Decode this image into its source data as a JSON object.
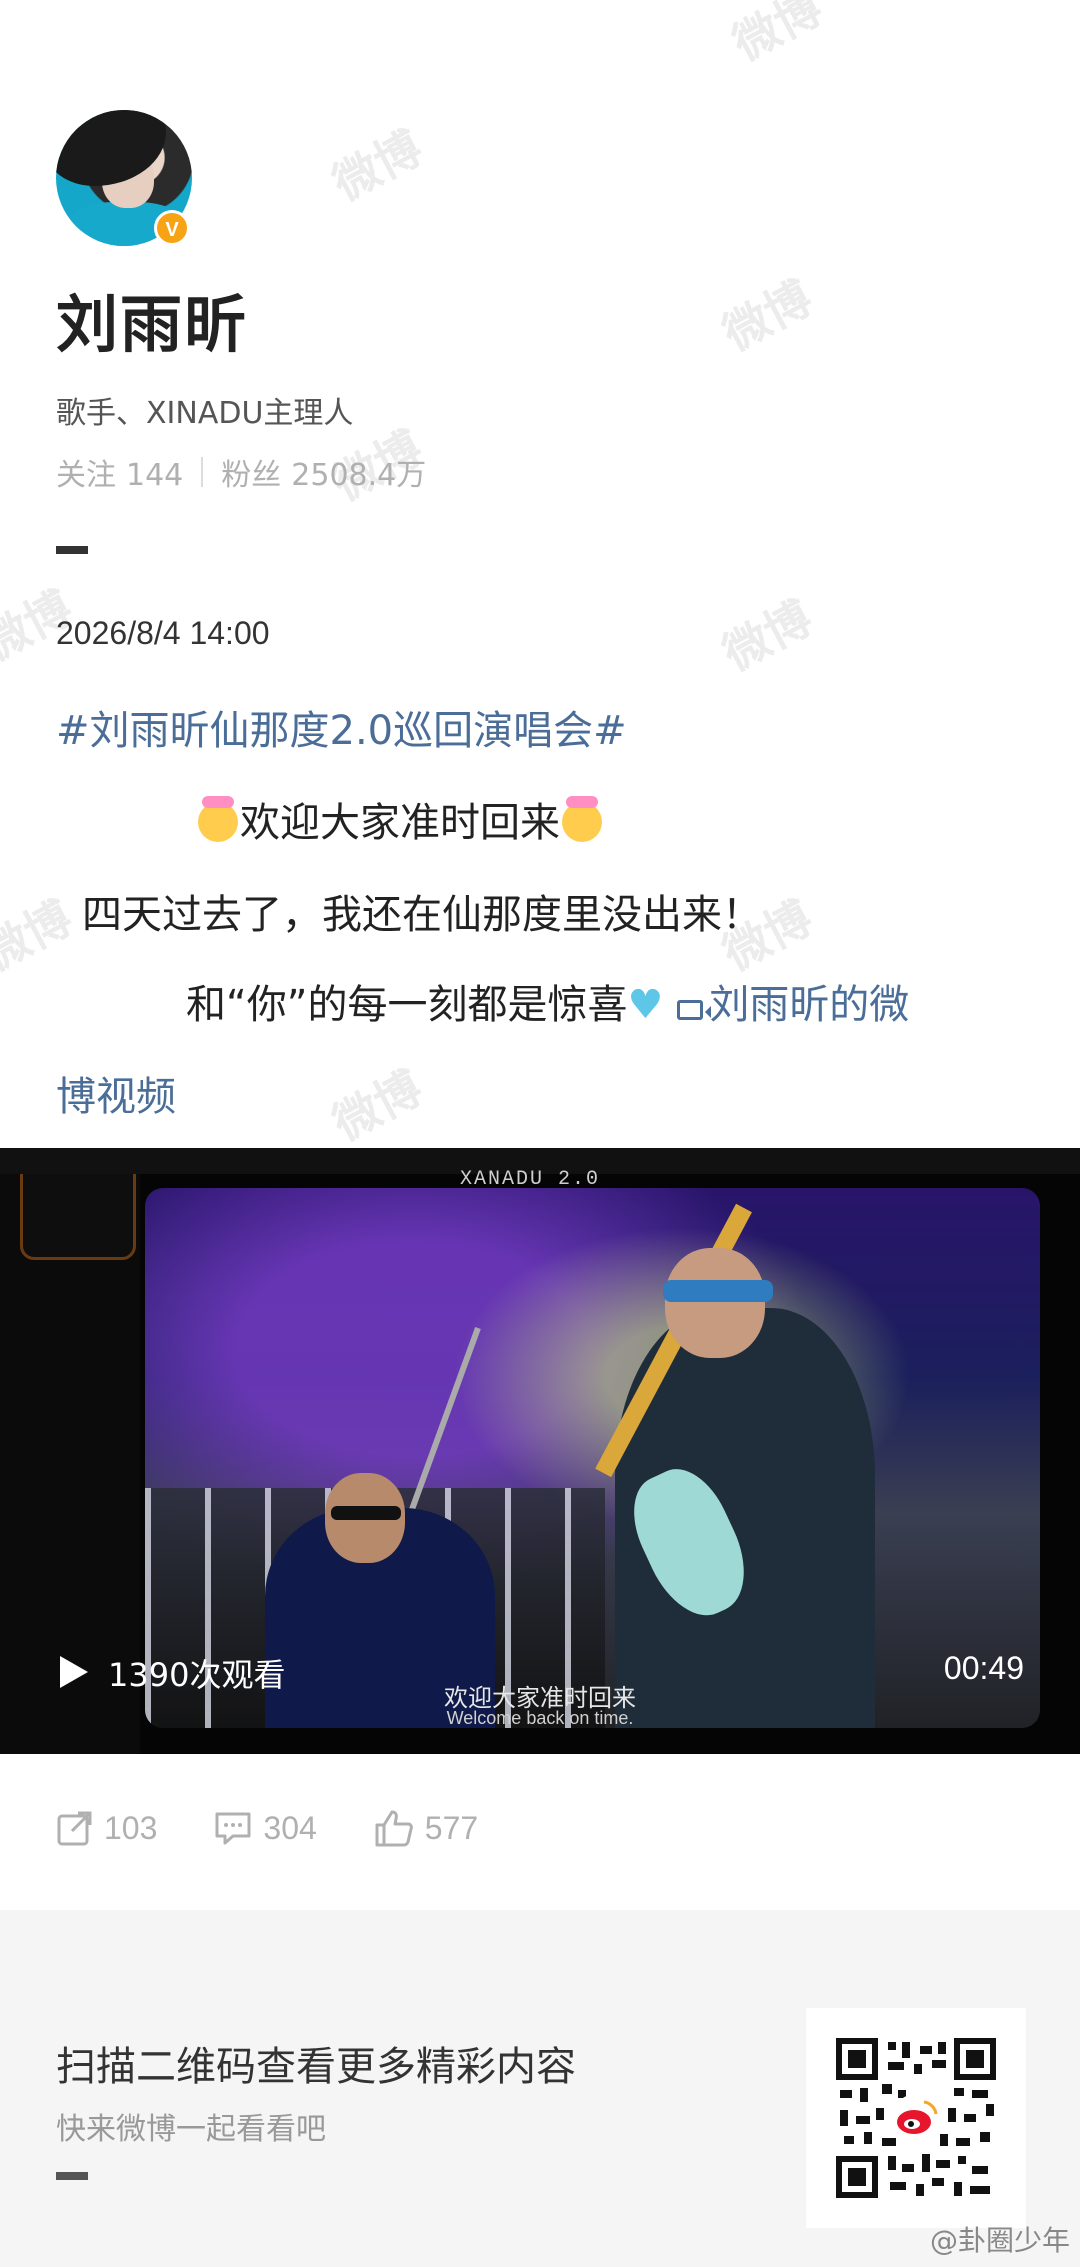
{
  "watermarks": [
    "微博",
    "微博",
    "微博",
    "微博",
    "微博",
    "微博",
    "微博",
    "微博",
    "微博"
  ],
  "profile": {
    "name": "刘雨昕",
    "bio": "歌手、XINADU主理人",
    "following_label": "关注",
    "following_count": "144",
    "followers_label": "粉丝",
    "followers_count": "2508.4万",
    "verified_badge": "V"
  },
  "post": {
    "timestamp": "2026/8/4 14:00",
    "hashtag": "#刘雨昕仙那度2.0巡回演唱会#",
    "line1": "欢迎大家准时回来",
    "line2": "四天过去了，我还在仙那度里没出来！",
    "line3": "和“你”的每一刻都是惊喜",
    "video_link_part1": "刘雨昕的微",
    "video_link_part2": "博视频"
  },
  "video": {
    "brand": "XANADU 2.0",
    "subtitle_cn": "欢迎大家准时回来",
    "subtitle_en": "Welcome back on time.",
    "views": "1390次观看",
    "duration": "00:49"
  },
  "actions": {
    "repost_count": "103",
    "comment_count": "304",
    "like_count": "577"
  },
  "footer": {
    "title": "扫描二维码查看更多精彩内容",
    "subtitle": "快来微博一起看看吧",
    "credit": "@卦圈少年"
  },
  "colors": {
    "link": "#4b6e98",
    "badge": "#f7a313",
    "muted": "#b0b0b0"
  }
}
